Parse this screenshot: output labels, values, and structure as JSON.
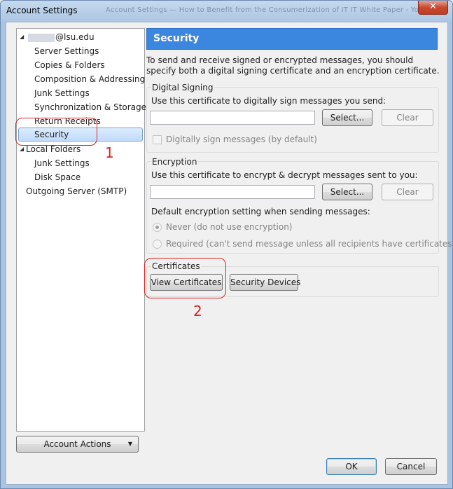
{
  "window": {
    "title": "Account Settings",
    "background_tab_text": "Account Settings — How to Benefit from the Consumerization of IT          IT White Paper - Yo",
    "close_symbol": "✕"
  },
  "sidebar": {
    "account_name": "@lsu.edu",
    "items": [
      {
        "label": "Server Settings"
      },
      {
        "label": "Copies & Folders"
      },
      {
        "label": "Composition & Addressing"
      },
      {
        "label": "Junk Settings"
      },
      {
        "label": "Synchronization & Storage"
      },
      {
        "label": "Return Receipts"
      },
      {
        "label": "Security",
        "selected": true
      }
    ],
    "local_folders": {
      "label": "Local Folders",
      "items": [
        {
          "label": "Junk Settings"
        },
        {
          "label": "Disk Space"
        }
      ]
    },
    "outgoing_server": "Outgoing Server (SMTP)",
    "account_actions_label": "Account Actions"
  },
  "security": {
    "header": "Security",
    "intro": "To send and receive signed or encrypted messages, you should specify both a digital signing certificate and an encryption certificate.",
    "digital_signing": {
      "label": "Digital Signing",
      "prompt": "Use this certificate to digitally sign messages you send:",
      "select_label": "Select...",
      "clear_label": "Clear",
      "checkbox_label": "Digitally sign messages (by default)"
    },
    "encryption": {
      "label": "Encryption",
      "prompt": "Use this certificate to encrypt & decrypt messages sent to you:",
      "select_label": "Select...",
      "clear_label": "Clear",
      "default_setting_label": "Default encryption setting when sending messages:",
      "option_never": "Never (do not use encryption)",
      "option_required": "Required (can't send message unless all recipients have certificates)"
    },
    "certificates": {
      "label": "Certificates",
      "view_label": "View Certificates",
      "devices_label": "Security Devices"
    }
  },
  "footer": {
    "ok_label": "OK",
    "cancel_label": "Cancel"
  },
  "annotations": {
    "one": "1",
    "two": "2"
  },
  "colors": {
    "header_blue": "#3b87e0",
    "annotation_red": "#e02020",
    "selection": "#c1dbfc"
  }
}
